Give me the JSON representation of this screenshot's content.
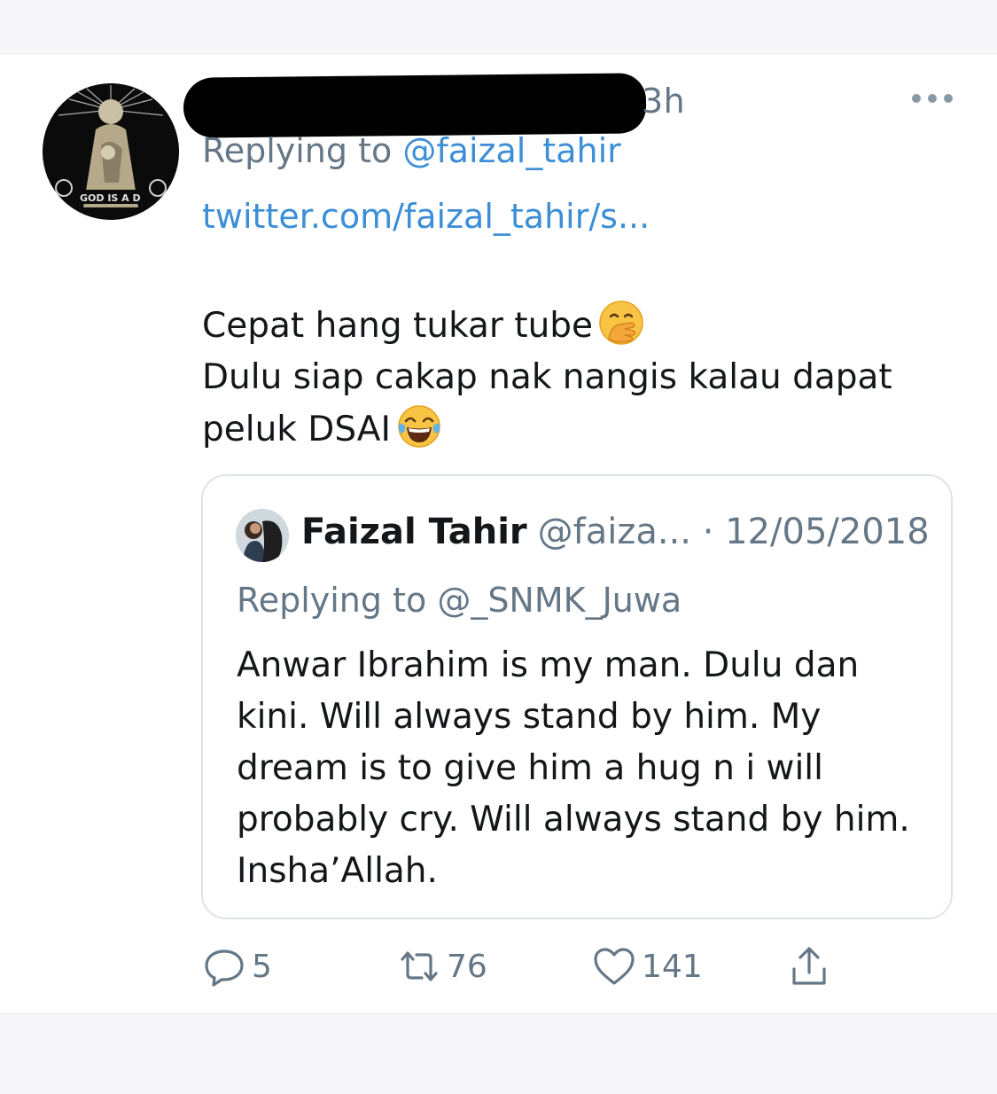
{
  "tweet": {
    "time": "3h",
    "replying_prefix": "Replying to ",
    "replying_handle": "@faizal_tahir",
    "link": "twitter.com/faizal_tahir/s...",
    "lines": [
      "Cepat hang tukar tube",
      "Dulu siap cakap nak nangis kalau dapat",
      "peluk DSAI"
    ],
    "emojis": [
      "face-with-hand-over-mouth",
      "face-with-tears-of-joy"
    ]
  },
  "quoted": {
    "name": "Faizal Tahir",
    "handle": "@faiza...",
    "date": "· 12/05/2018",
    "replying_prefix": "Replying to ",
    "replying_handle": "@_SNMK_Juwa",
    "text": "Anwar Ibrahim is my man. Dulu dan kini. Will always stand by him. My dream is to give him a hug n i will probably cry. Will always stand by him. Insha’Allah."
  },
  "actions": {
    "replies": "5",
    "retweets": "76",
    "likes": "141"
  },
  "colors": {
    "link": "#3d8ed7",
    "muted": "#657786",
    "text": "#14171a",
    "border": "#dfe3e7"
  }
}
